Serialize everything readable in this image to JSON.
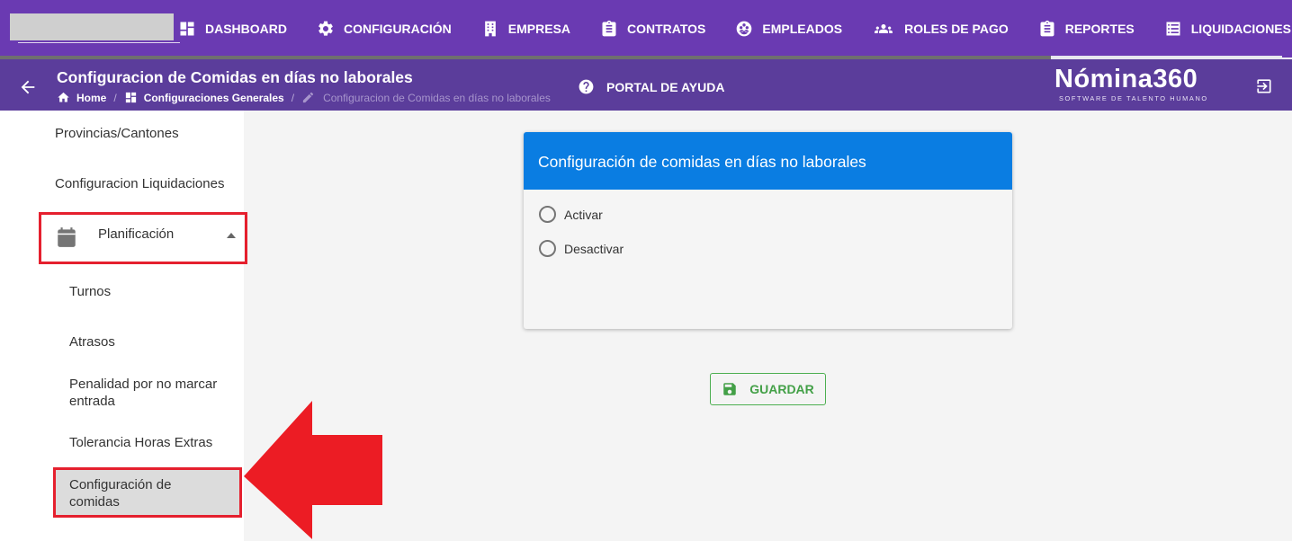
{
  "nav": {
    "items": [
      {
        "label": "DASHBOARD",
        "icon": "dashboard-icon"
      },
      {
        "label": "CONFIGURACIÓN",
        "icon": "gear-icon"
      },
      {
        "label": "EMPRESA",
        "icon": "building-icon"
      },
      {
        "label": "CONTRATOS",
        "icon": "clipboard-icon"
      },
      {
        "label": "EMPLEADOS",
        "icon": "user-group-icon"
      },
      {
        "label": "ROLES DE PAGO",
        "icon": "users-icon"
      },
      {
        "label": "REPORTES",
        "icon": "clipboard-icon"
      },
      {
        "label": "LIQUIDACIONES",
        "icon": "list-icon"
      }
    ],
    "overflow_icon": "calendar-icon"
  },
  "header": {
    "title": "Configuracion de Comidas en días no laborales",
    "breadcrumb": {
      "home": "Home",
      "section": "Configuraciones Generales",
      "current": "Configuracion de Comidas en días no laborales",
      "separator": "/"
    },
    "help_label": "PORTAL DE AYUDA",
    "brand_name": "Nómina360",
    "brand_tagline": "SOFTWARE DE TALENTO HUMANO"
  },
  "sidebar": {
    "items": [
      {
        "label": "Provincias/Cantones"
      },
      {
        "label": "Configuracion Liquidaciones"
      }
    ],
    "group": {
      "label": "Planificación",
      "expanded": true,
      "icon": "calendar-icon"
    },
    "sub_items": [
      {
        "label": "Turnos"
      },
      {
        "label": "Atrasos"
      },
      {
        "label": "Penalidad por no marcar entrada"
      },
      {
        "label": "Tolerancia Horas Extras"
      }
    ],
    "active_item": {
      "label": "Configuración de comidas"
    }
  },
  "card": {
    "title": "Configuración de comidas en días no laborales",
    "options": [
      {
        "label": "Activar",
        "selected": false
      },
      {
        "label": "Desactivar",
        "selected": false
      }
    ]
  },
  "save_button": {
    "label": "GUARDAR",
    "icon": "floppy-disk-icon"
  },
  "colors": {
    "nav_bg": "#6a3ab2",
    "subheader_bg": "#5b3d9b",
    "card_header": "#0a7de2",
    "save_green": "#43a047",
    "highlight_red": "#e5202e"
  }
}
